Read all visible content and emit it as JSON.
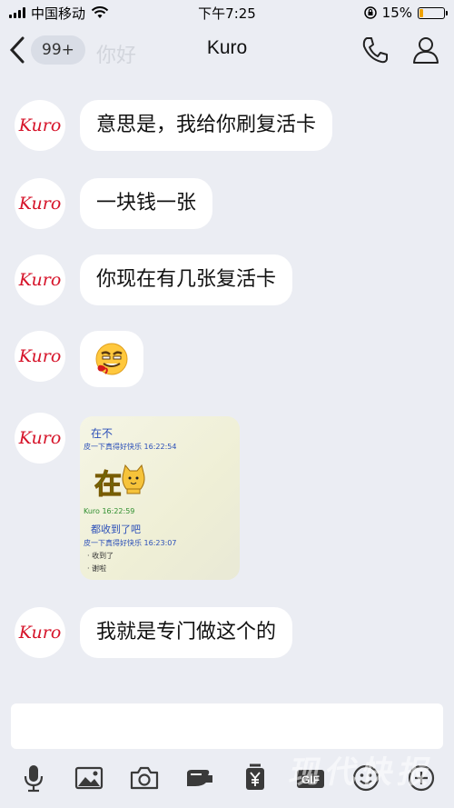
{
  "status_bar": {
    "carrier": "中国移动",
    "time": "下午7:25",
    "battery": "15%",
    "battery_fraction": 0.15
  },
  "nav": {
    "unread_badge": "99+",
    "ghost_text": "你好",
    "title": "Kuro"
  },
  "messages": [
    {
      "avatar": "Kuro",
      "text": "意思是，我给你刷复活卡"
    },
    {
      "avatar": "Kuro",
      "text": "一块钱一张"
    },
    {
      "avatar": "Kuro",
      "text": "你现在有几张复活卡"
    },
    {
      "avatar": "Kuro",
      "emoji": "grimace-bleeding-emoji"
    },
    {
      "avatar": "Kuro",
      "image": {
        "line1": "在不",
        "line2": "皮一下真得好快乐  16:22:54",
        "sticker": "在",
        "line3": "Kuro   16:22:59",
        "line4": "都收到了吧",
        "line5": "皮一下真得好快乐  16:23:07",
        "line6": "· 收到了",
        "line7": "· 谢啦"
      }
    },
    {
      "avatar": "Kuro",
      "text": "我就是专门做这个的"
    }
  ],
  "toolbar": {
    "icons": [
      "microphone-icon",
      "picture-icon",
      "camera-icon",
      "red-packet-icon",
      "yuan-transfer-icon",
      "gif-icon",
      "smiley-icon",
      "plus-icon"
    ]
  },
  "watermark": "现代快报"
}
